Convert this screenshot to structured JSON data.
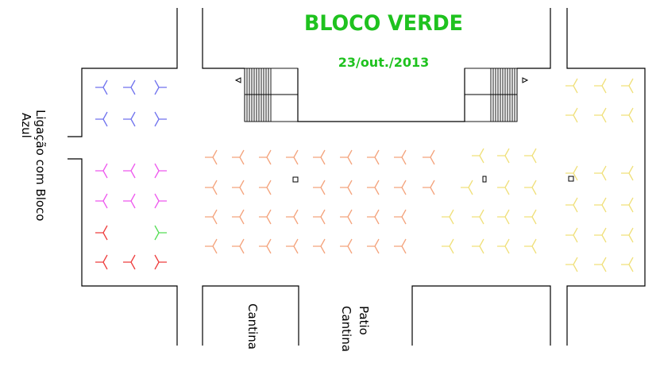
{
  "title": "BLOCO VERDE",
  "date": "23/out./2013",
  "labels": {
    "ligacao_line1": "Ligação  com Bloco",
    "ligacao_line2": "Azul",
    "cantina": "Cantina",
    "patio_line1": "Patio",
    "patio_line2": "Cantina"
  },
  "colors": {
    "title": "#1fc21f",
    "blue": "#6f72ee",
    "magenta": "#ee57ee",
    "red": "#ee3d3d",
    "green": "#55dd55",
    "orange": "#f4a37c",
    "yellow": "#f0e07a",
    "walls": "#000000"
  }
}
